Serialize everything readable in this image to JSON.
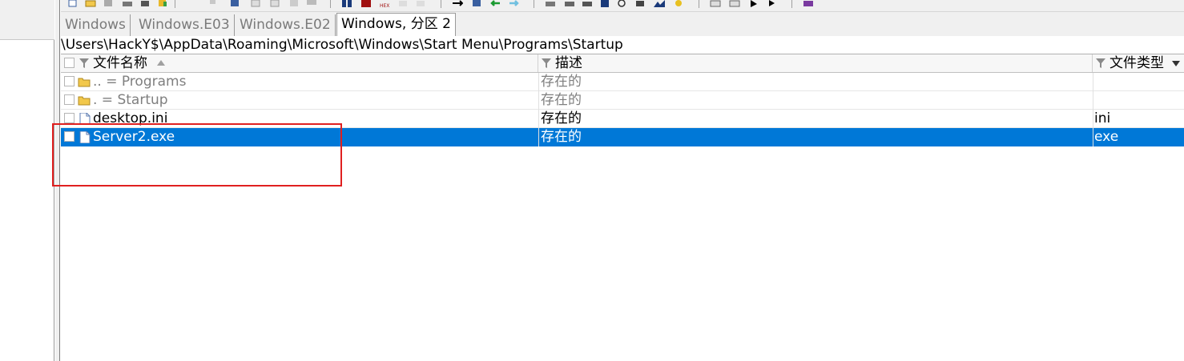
{
  "tabs": [
    {
      "label": "Windows",
      "active": false
    },
    {
      "label": "Windows.E03",
      "active": false
    },
    {
      "label": "Windows.E02",
      "active": false
    },
    {
      "label": "Windows, 分区 2",
      "active": true
    }
  ],
  "path": "\\Users\\HackY$\\AppData\\Roaming\\Microsoft\\Windows\\Start Menu\\Programs\\Startup",
  "columns": {
    "name": "文件名称",
    "description": "描述",
    "type": "文件类型"
  },
  "rows": [
    {
      "name": "..   =   Programs",
      "description": "存在的",
      "type": "",
      "icon": "folder-icon",
      "selected": false
    },
    {
      "name": ".    =   Startup",
      "description": "存在的",
      "type": "",
      "icon": "folder-icon",
      "selected": false
    },
    {
      "name": "desktop.ini",
      "description": "存在的",
      "type": "ini",
      "icon": "file-icon",
      "selected": false
    },
    {
      "name": "Server2.exe",
      "description": "存在的",
      "type": "exe",
      "icon": "file-icon",
      "selected": true
    }
  ],
  "toolbar_icons": [
    "new-icon",
    "open-icon",
    "save-icon",
    "print-icon",
    "properties-icon",
    "paste-icon",
    "copy-icon",
    "copy-alt-icon",
    "clipboard-icon",
    "ref-icon",
    "find-icon",
    "find-binoculars-icon",
    "hex-icon",
    "find-next-icon",
    "replace-icon",
    "goto-icon",
    "goto-sector-icon",
    "back-icon",
    "forward-icon",
    "disk-icon",
    "disk-alt-icon",
    "disk-image-icon",
    "calculator-icon",
    "search-icon",
    "tools-icon",
    "graph-icon",
    "settings-icon",
    "compare-icon",
    "hex-view-icon",
    "arrow-icon",
    "play-icon",
    "help-book-icon"
  ],
  "colors": {
    "selection": "#0078d7",
    "annotation": "#e02020",
    "folder": "#f2c84b"
  }
}
